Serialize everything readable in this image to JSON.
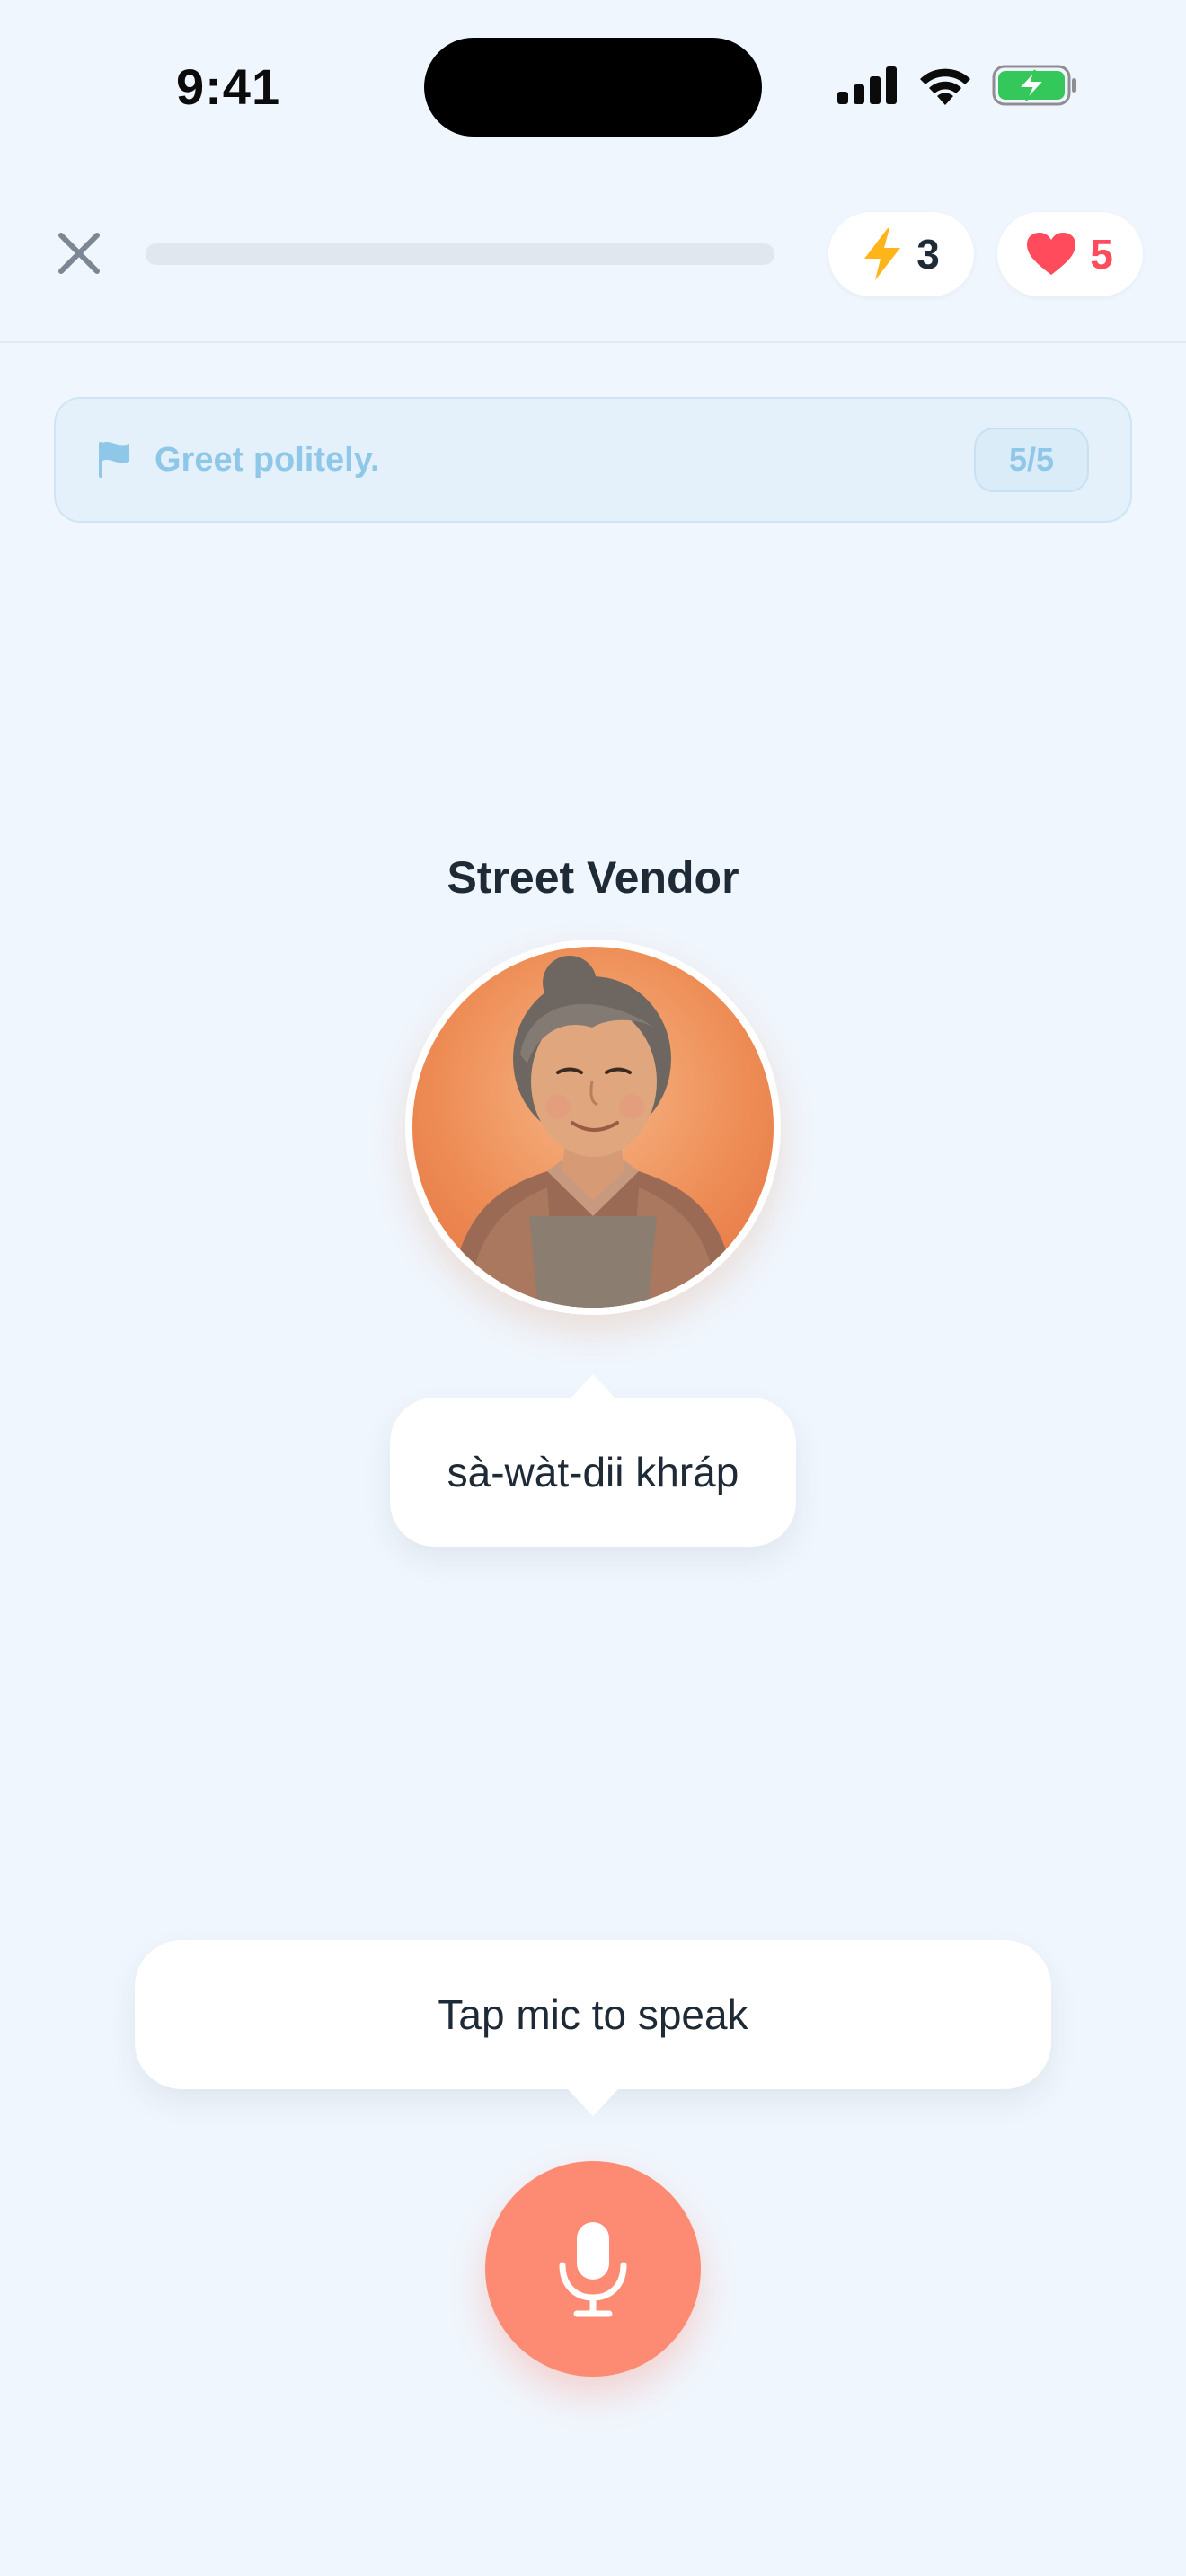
{
  "status_bar": {
    "time": "9:41"
  },
  "header": {
    "progress": 0,
    "energy_count": "3",
    "hearts_count": "5"
  },
  "goal": {
    "text": "Greet politely.",
    "counter": "5/5"
  },
  "character": {
    "name": "Street Vendor"
  },
  "speech": {
    "text": "sà-wàt-dii khráp"
  },
  "prompt": {
    "text": "Tap mic to speak"
  },
  "colors": {
    "background": "#f0f6fd",
    "energy": "#ffb41a",
    "heart": "#ff4b5c",
    "goal_text": "#8fc7e8",
    "mic": "#fd8a72",
    "battery": "#34c759"
  },
  "icons": {
    "close": "close-icon",
    "energy": "lightning-icon",
    "heart": "heart-icon",
    "goal": "flag-icon",
    "mic": "microphone-icon"
  }
}
